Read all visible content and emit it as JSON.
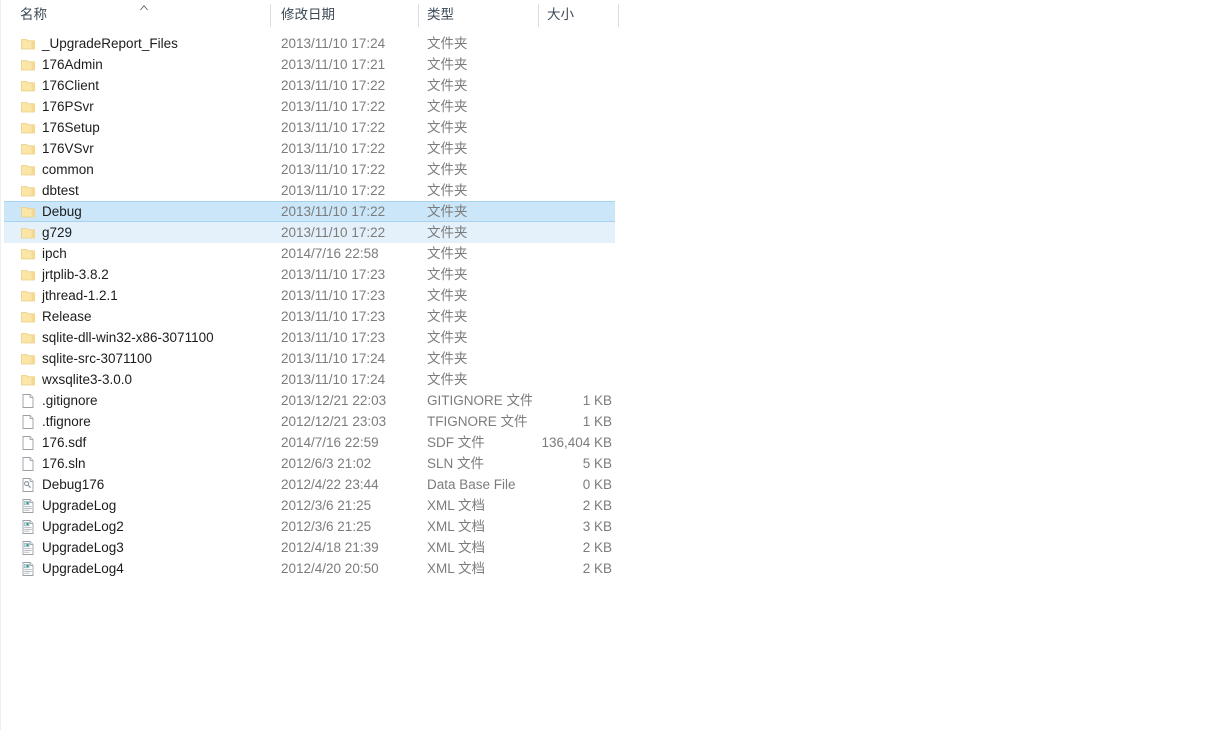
{
  "view": {
    "kind": "file-explorer-details-list",
    "background": "#ffffff",
    "selection_strong_color": "#cbe6f8",
    "selection_light_color": "#e4f1fb",
    "selection_border_color": "#a7d3ee",
    "header_text_color": "#3c4a56",
    "name_text_color": "#1c1c1c",
    "meta_text_color": "#7c7c7c",
    "folder_icon_color": "#fbe09a",
    "file_icon_color": "#9aa0a6"
  },
  "columns": {
    "name": "名称",
    "date_modified": "修改日期",
    "type": "类型",
    "size": "大小",
    "sort_indicator": "sort-ascending-caret",
    "sorted_by": "名称"
  },
  "rows": [
    {
      "icon": "folder-icon",
      "name": "_UpgradeReport_Files",
      "date": "2013/11/10 17:24",
      "type": "文件夹",
      "size": "",
      "state": "normal"
    },
    {
      "icon": "folder-icon",
      "name": "176Admin",
      "date": "2013/11/10 17:21",
      "type": "文件夹",
      "size": "",
      "state": "normal"
    },
    {
      "icon": "folder-icon",
      "name": "176Client",
      "date": "2013/11/10 17:22",
      "type": "文件夹",
      "size": "",
      "state": "normal"
    },
    {
      "icon": "folder-icon",
      "name": "176PSvr",
      "date": "2013/11/10 17:22",
      "type": "文件夹",
      "size": "",
      "state": "normal"
    },
    {
      "icon": "folder-icon",
      "name": "176Setup",
      "date": "2013/11/10 17:22",
      "type": "文件夹",
      "size": "",
      "state": "normal"
    },
    {
      "icon": "folder-icon",
      "name": "176VSvr",
      "date": "2013/11/10 17:22",
      "type": "文件夹",
      "size": "",
      "state": "normal"
    },
    {
      "icon": "folder-icon",
      "name": "common",
      "date": "2013/11/10 17:22",
      "type": "文件夹",
      "size": "",
      "state": "normal"
    },
    {
      "icon": "folder-icon",
      "name": "dbtest",
      "date": "2013/11/10 17:22",
      "type": "文件夹",
      "size": "",
      "state": "normal"
    },
    {
      "icon": "folder-icon",
      "name": "Debug",
      "date": "2013/11/10 17:22",
      "type": "文件夹",
      "size": "",
      "state": "selected"
    },
    {
      "icon": "folder-icon",
      "name": "g729",
      "date": "2013/11/10 17:22",
      "type": "文件夹",
      "size": "",
      "state": "highlighted"
    },
    {
      "icon": "folder-icon",
      "name": "ipch",
      "date": "2014/7/16 22:58",
      "type": "文件夹",
      "size": "",
      "state": "normal"
    },
    {
      "icon": "folder-icon",
      "name": "jrtplib-3.8.2",
      "date": "2013/11/10 17:23",
      "type": "文件夹",
      "size": "",
      "state": "normal"
    },
    {
      "icon": "folder-icon",
      "name": "jthread-1.2.1",
      "date": "2013/11/10 17:23",
      "type": "文件夹",
      "size": "",
      "state": "normal"
    },
    {
      "icon": "folder-icon",
      "name": "Release",
      "date": "2013/11/10 17:23",
      "type": "文件夹",
      "size": "",
      "state": "normal"
    },
    {
      "icon": "folder-icon",
      "name": "sqlite-dll-win32-x86-3071100",
      "date": "2013/11/10 17:23",
      "type": "文件夹",
      "size": "",
      "state": "normal"
    },
    {
      "icon": "folder-icon",
      "name": "sqlite-src-3071100",
      "date": "2013/11/10 17:24",
      "type": "文件夹",
      "size": "",
      "state": "normal"
    },
    {
      "icon": "folder-icon",
      "name": "wxsqlite3-3.0.0",
      "date": "2013/11/10 17:24",
      "type": "文件夹",
      "size": "",
      "state": "normal"
    },
    {
      "icon": "document-icon",
      "name": ".gitignore",
      "date": "2013/12/21 22:03",
      "type": "GITIGNORE 文件",
      "size": "1 KB",
      "state": "normal"
    },
    {
      "icon": "document-icon",
      "name": ".tfignore",
      "date": "2012/12/21 23:03",
      "type": "TFIGNORE 文件",
      "size": "1 KB",
      "state": "normal"
    },
    {
      "icon": "document-icon",
      "name": "176.sdf",
      "date": "2014/7/16 22:59",
      "type": "SDF 文件",
      "size": "136,404 KB",
      "state": "normal"
    },
    {
      "icon": "document-icon",
      "name": "176.sln",
      "date": "2012/6/3 21:02",
      "type": "SLN 文件",
      "size": "5 KB",
      "state": "normal"
    },
    {
      "icon": "database-file-icon",
      "name": "Debug176",
      "date": "2012/4/22 23:44",
      "type": "Data Base File",
      "size": "0 KB",
      "state": "normal"
    },
    {
      "icon": "xml-document-icon",
      "name": "UpgradeLog",
      "date": "2012/3/6 21:25",
      "type": "XML 文档",
      "size": "2 KB",
      "state": "normal"
    },
    {
      "icon": "xml-document-icon",
      "name": "UpgradeLog2",
      "date": "2012/3/6 21:25",
      "type": "XML 文档",
      "size": "3 KB",
      "state": "normal"
    },
    {
      "icon": "xml-document-icon",
      "name": "UpgradeLog3",
      "date": "2012/4/18 21:39",
      "type": "XML 文档",
      "size": "2 KB",
      "state": "normal"
    },
    {
      "icon": "xml-document-icon",
      "name": "UpgradeLog4",
      "date": "2012/4/20 20:50",
      "type": "XML 文档",
      "size": "2 KB",
      "state": "normal"
    }
  ]
}
